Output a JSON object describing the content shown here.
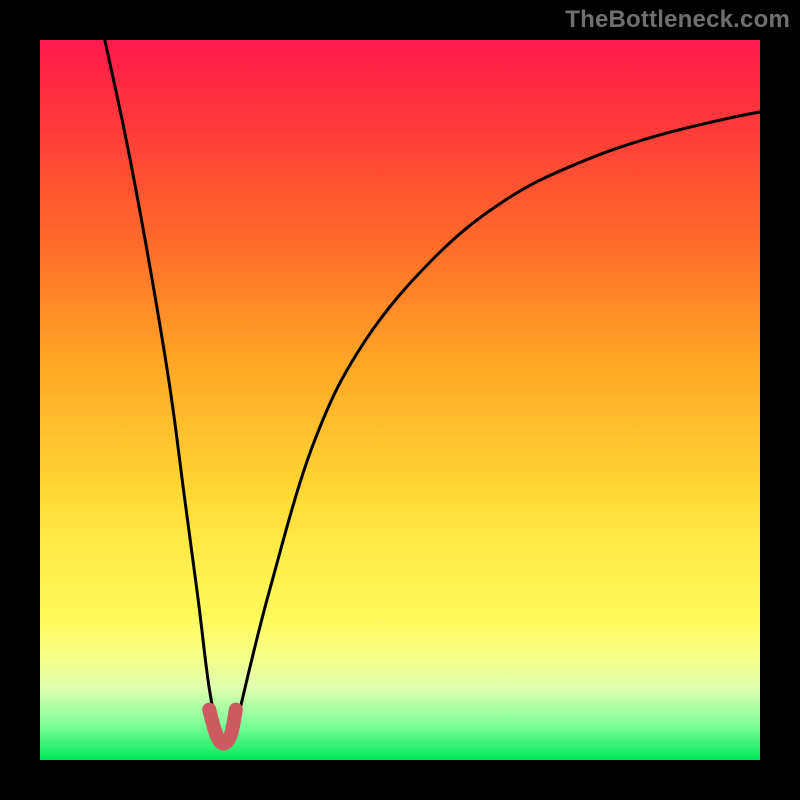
{
  "watermark": "TheBottleneck.com",
  "chart_data": {
    "type": "line",
    "title": "",
    "xlabel": "",
    "ylabel": "",
    "xlim": [
      0,
      100
    ],
    "ylim": [
      0,
      100
    ],
    "series": [
      {
        "name": "bottleneck-curve",
        "x": [
          9,
          12,
          15,
          18,
          20,
          22,
          23.5,
          25,
          26,
          27,
          28,
          32,
          38,
          45,
          55,
          65,
          75,
          85,
          95,
          100
        ],
        "values": [
          100,
          86,
          70,
          52,
          37,
          22,
          10,
          3,
          2,
          3,
          8,
          24,
          44,
          58,
          70,
          78,
          83,
          86.5,
          89,
          90
        ]
      },
      {
        "name": "highlight-min",
        "x": [
          23.5,
          24.5,
          25.5,
          26.5,
          27.2
        ],
        "values": [
          7,
          3.5,
          2.3,
          3.5,
          7
        ]
      }
    ],
    "colors": {
      "curve": "#000000",
      "highlight": "#cc5a60"
    }
  }
}
